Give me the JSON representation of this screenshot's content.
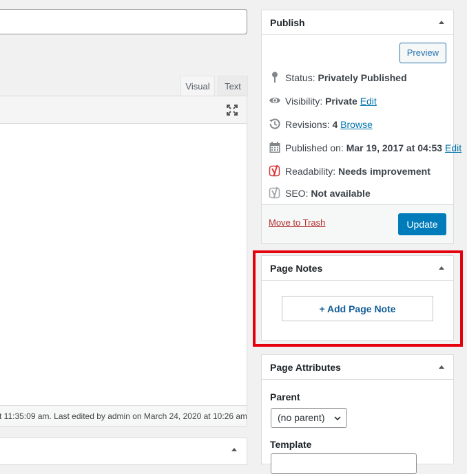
{
  "editor": {
    "tabs": {
      "visual": "Visual",
      "text": "Text"
    },
    "footer_text": "t 11:35:09 am. Last edited by admin on March 24, 2020 at 10:26 am"
  },
  "publish": {
    "title": "Publish",
    "preview_label": "Preview",
    "status_label": "Status:",
    "status_value": "Privately Published",
    "visibility_label": "Visibility:",
    "visibility_value": "Private",
    "visibility_edit": "Edit",
    "revisions_label": "Revisions:",
    "revisions_value": "4",
    "revisions_browse": "Browse",
    "published_label": "Published on:",
    "published_value": "Mar 19, 2017 at 04:53",
    "published_edit": "Edit",
    "readability_label": "Readability:",
    "readability_value": "Needs improvement",
    "seo_label": "SEO:",
    "seo_value": "Not available",
    "trash_label": "Move to Trash",
    "update_label": "Update"
  },
  "page_notes": {
    "title": "Page Notes",
    "add_label": "+ Add Page Note"
  },
  "page_attributes": {
    "title": "Page Attributes",
    "parent_label": "Parent",
    "parent_value": "(no parent)",
    "template_label": "Template"
  },
  "colors": {
    "accent": "#007cba",
    "link": "#0073aa",
    "trash": "#b32d2e",
    "highlight": "#e5000e",
    "readability_icon": "#dc3232",
    "seo_icon": "#a0a5aa"
  },
  "icons": {
    "status": "pin-icon",
    "visibility": "eye-icon",
    "revisions": "history-icon",
    "published": "calendar-icon",
    "readability": "yoast-icon",
    "seo": "yoast-icon",
    "fullscreen": "fullscreen-icon"
  }
}
